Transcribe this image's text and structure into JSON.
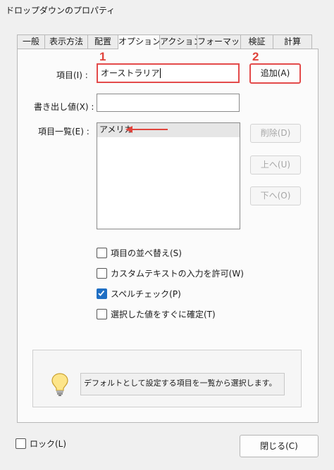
{
  "window": {
    "title": "ドロップダウンのプロパティ"
  },
  "tabs": [
    {
      "label": "一般",
      "active": false
    },
    {
      "label": "表示方法",
      "active": false
    },
    {
      "label": "配置",
      "active": false
    },
    {
      "label": "オプション",
      "active": true
    },
    {
      "label": "アクション",
      "active": false
    },
    {
      "label": "フォーマット",
      "active": false
    },
    {
      "label": "検証",
      "active": false
    },
    {
      "label": "計算",
      "active": false
    }
  ],
  "options": {
    "item_label": "項目(I) :",
    "item_value": "オーストラリア",
    "export_label": "書き出し値(X) :",
    "export_value": "",
    "list_label": "項目一覧(E) :",
    "list_items": [
      "アメリカ"
    ],
    "add_button": "追加(A)",
    "delete_button": "削除(D)",
    "up_button": "上へ(U)",
    "down_button": "下へ(O)",
    "checkboxes": [
      {
        "label": "項目の並べ替え(S)",
        "checked": false
      },
      {
        "label": "カスタムテキストの入力を許可(W)",
        "checked": false
      },
      {
        "label": "スペルチェック(P)",
        "checked": true
      },
      {
        "label": "選択した値をすぐに確定(T)",
        "checked": false
      }
    ],
    "hint": "デフォルトとして設定する項目を一覧から選択します。"
  },
  "annotations": {
    "step1": "1",
    "step2": "2",
    "color": "#e0443c"
  },
  "footer": {
    "lock_label": "ロック(L)",
    "lock_checked": false,
    "close_button": "閉じる(C)"
  },
  "icons": {
    "hint": "lightbulb-icon",
    "check": "checkmark-icon",
    "arrow": "red-arrow-left"
  }
}
